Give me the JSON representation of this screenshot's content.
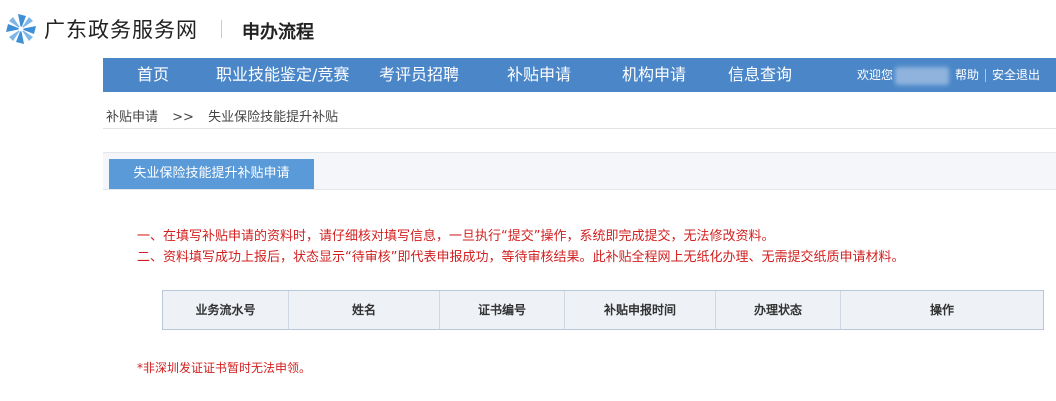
{
  "header": {
    "site_name": "广东政务服务网",
    "page_heading": "申办流程",
    "logo_icon": "pinwheel-logo-icon",
    "brand_color": "#4b87c8"
  },
  "nav": {
    "items": [
      "首页",
      "职业技能鉴定/竞赛",
      "考评员招聘",
      "补贴申请",
      "机构申请",
      "信息查询"
    ],
    "welcome": "欢迎您",
    "help": "帮助",
    "logout": "安全退出"
  },
  "breadcrumb": {
    "parent": "补贴申请",
    "separator": ">>",
    "current": "失业保险技能提升补贴"
  },
  "panel": {
    "tab_label": "失业保险技能提升补贴申请",
    "notices": [
      "一、在填写补贴申请的资料时，请仔细核对填写信息，一旦执行“提交”操作，系统即完成提交，无法修改资料。",
      "二、资料填写成功上报后，状态显示“待审核”即代表申报成功，等待审核结果。此补贴全程网上无纸化办理、无需提交纸质申请材料。"
    ],
    "table_headers": [
      "业务流水号",
      "姓名",
      "证书编号",
      "补贴申报时间",
      "办理状态",
      "操作"
    ],
    "footnote": "*非深圳发证证书暂时无法申领。",
    "notice_color": "#d21f1f"
  }
}
